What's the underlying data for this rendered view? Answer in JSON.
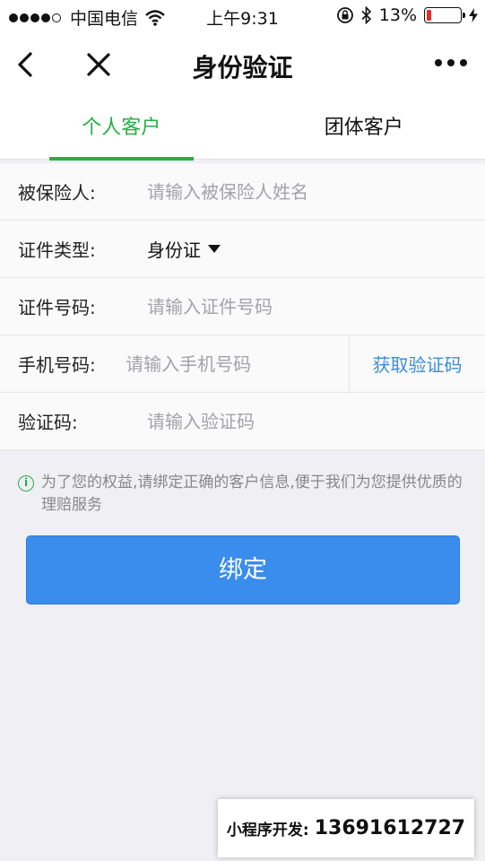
{
  "status_bar": {
    "carrier": "中国电信",
    "time": "上午9:31",
    "battery_percent": "13%",
    "battery_level": 0.13,
    "signal_icon": "signal-dots",
    "wifi_icon": "wifi-icon",
    "bluetooth_icon": "bluetooth-icon",
    "lock_icon": "orientation-lock-icon",
    "charging_icon": "bolt-icon"
  },
  "nav": {
    "title": "身份验证",
    "back_icon": "chevron-left-icon",
    "close_icon": "close-icon",
    "more_icon": "more-dots-icon"
  },
  "tabs": [
    {
      "label": "个人客户",
      "active": true
    },
    {
      "label": "团体客户",
      "active": false
    }
  ],
  "form": {
    "insured": {
      "label": "被保险人:",
      "placeholder": "请输入被保险人姓名"
    },
    "id_type": {
      "label": "证件类型:",
      "value": "身份证"
    },
    "id_number": {
      "label": "证件号码:",
      "placeholder": "请输入证件号码"
    },
    "phone": {
      "label": "手机号码:",
      "placeholder": "请输入手机号码",
      "code_button": "获取验证码"
    },
    "code": {
      "label": "验证码:",
      "placeholder": "请输入验证码"
    }
  },
  "notice": {
    "icon": "info-icon",
    "text": "为了您的权益,请绑定正确的客户信息,便于我们为您提供优质的理赔服务"
  },
  "bind_button": {
    "label": "绑定"
  },
  "banner": {
    "label": "小程序开发:",
    "phone": "13691612727"
  },
  "colors": {
    "accent_green": "#2aae47",
    "button_blue": "#3a8ced",
    "link_blue": "#3b8ddb",
    "battery_red": "#e2312d",
    "background": "#efeff4"
  }
}
